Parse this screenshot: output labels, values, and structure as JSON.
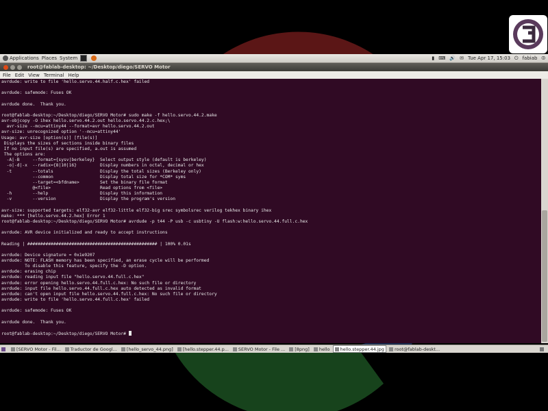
{
  "top_panel": {
    "menus": [
      "Applications",
      "Places",
      "System"
    ],
    "clock": "Tue Apr 17, 15:03",
    "user": "fabiab"
  },
  "window": {
    "title": "root@fablab-desktop: ~/Desktop/diego/SERVO Motor"
  },
  "menu_bar": [
    "File",
    "Edit",
    "View",
    "Terminal",
    "Help"
  ],
  "terminal_lines": [
    "avrdude: write to file 'hello.servo.44.half.c.hex' failed",
    "",
    "avrdude: safemode: Fuses OK",
    "",
    "avrdude done.  Thank you.",
    "",
    "root@fablab-desktop:~/Desktop/diego/SERVO Motor# sudo make -f hello.servo.44.2.make",
    "avr-objcopy -O ihex hello.servo.44.2.out hello.servo.44.2.c.hex;\\",
    "  avr-size --mcu=attiny44 --format=avr hello.servo.44.2.out",
    "avr-size: unrecognized option '--mcu=attiny44'",
    "Usage: avr-size [option(s)] [file(s)]",
    " Displays the sizes of sections inside binary files",
    " If no input file(s) are specified, a.out is assumed",
    " The options are:",
    "  -A|-B     --format={sysv|berkeley}  Select output style (default is berkeley)",
    "  -o|-d|-x  --radix={8|10|16}         Display numbers in octal, decimal or hex",
    "  -t        --totals                  Display the total sizes (Berkeley only)",
    "            --common                  Display total size for *COM* syms",
    "            --target=<bfdname>        Set the binary file format",
    "            @<file>                   Read options from <file>",
    "  -h        --help                    Display this information",
    "  -v        --version                 Display the program's version",
    "",
    "avr-size: supported targets: elf32-avr elf32-little elf32-big srec symbolsrec verilog tekhex binary ihex",
    "make: *** [hello.servo.44.2.hex] Error 1",
    "root@fablab-desktop:~/Desktop/diego/SERVO Motor# avrdude -p t44 -P usb -c usbtiny -U flash:w:hello.servo.44.full.c.hex",
    "",
    "avrdude: AVR device initialized and ready to accept instructions",
    "",
    "Reading | ################################################## | 100% 0.01s",
    "",
    "avrdude: Device signature = 0x1e9207",
    "avrdude: NOTE: FLASH memory has been specified, an erase cycle will be performed",
    "         To disable this feature, specify the -D option.",
    "avrdude: erasing chip",
    "avrdude: reading input file \"hello.servo.44.full.c.hex\"",
    "avrdude: error opening hello.servo.44.full.c.hex: No such file or directory",
    "avrdude: input file hello.servo.44.full.c.hex auto detected as invalid format",
    "avrdude: can't open input file hello.servo.44.full.c.hex: No such file or directory",
    "avrdude: write to file 'hello.servo.44.full.c.hex' failed",
    "",
    "avrdude: safemode: Fuses OK",
    "",
    "avrdude done.  Thank you.",
    "",
    "root@fablab-desktop:~/Desktop/diego/SERVO Motor# "
  ],
  "taskbar": [
    {
      "label": "[SERVO Motor - Fil...",
      "active": false
    },
    {
      "label": "Traductor de Googl...",
      "active": false
    },
    {
      "label": "[hello_servo_44.png]",
      "active": false
    },
    {
      "label": "[hello.stepper.44.p...",
      "active": false
    },
    {
      "label": "SERVO Motor - File ...",
      "active": false
    },
    {
      "label": "[8png]",
      "active": false
    },
    {
      "label": "hello",
      "active": false
    },
    {
      "label": "hello.stepper.44.jpg",
      "active": true
    },
    {
      "label": "root@fablab-deskt...",
      "active": false
    }
  ],
  "colors": {
    "terminal_bg": "#300a24",
    "terminal_fg": "#e8e8e8",
    "panel_bg": "#d9d6d0"
  }
}
